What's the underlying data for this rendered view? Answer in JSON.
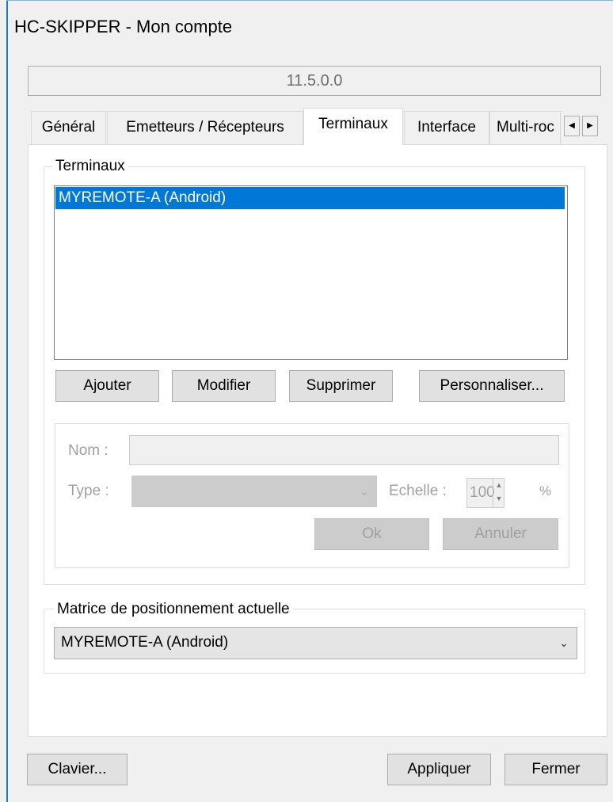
{
  "window": {
    "title": "HC-SKIPPER - Mon compte"
  },
  "version": "11.5.0.0",
  "tabs": [
    {
      "label": "Général",
      "active": false
    },
    {
      "label": "Emetteurs / Récepteurs",
      "active": false
    },
    {
      "label": "Terminaux",
      "active": true
    },
    {
      "label": "Interface",
      "active": false
    },
    {
      "label": "Multi-roc",
      "active": false
    }
  ],
  "tab_scroll": {
    "left_icon": "triangle-left",
    "right_icon": "triangle-right"
  },
  "terminaux": {
    "group_title": "Terminaux",
    "list_items": [
      {
        "label": "MYREMOTE-A (Android)",
        "selected": true
      }
    ],
    "buttons": {
      "add": "Ajouter",
      "edit": "Modifier",
      "delete": "Supprimer",
      "customize": "Personnaliser..."
    },
    "edit_form": {
      "name_label": "Nom :",
      "name_value": "",
      "type_label": "Type :",
      "type_value": "",
      "scale_label": "Echelle :",
      "scale_value": "100",
      "scale_unit": "%",
      "ok_label": "Ok",
      "cancel_label": "Annuler",
      "enabled": false
    }
  },
  "matrix": {
    "group_title": "Matrice de positionnement actuelle",
    "selected": "MYREMOTE-A (Android)"
  },
  "footer": {
    "keyboard": "Clavier...",
    "apply": "Appliquer",
    "close": "Fermer"
  },
  "colors": {
    "selection": "#0078d7",
    "window_border": "#1979ca"
  }
}
